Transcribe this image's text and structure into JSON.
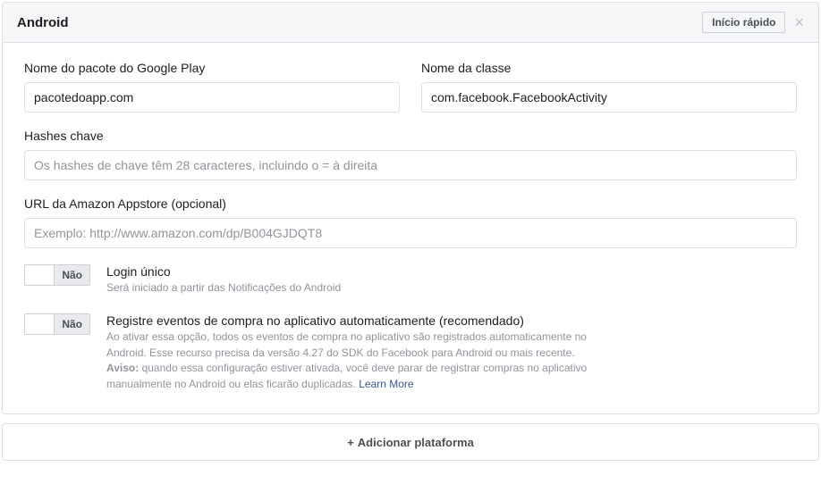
{
  "header": {
    "title": "Android",
    "quick_start": "Início rápido"
  },
  "fields": {
    "package_label": "Nome do pacote do Google Play",
    "package_value": "pacotedoapp.com",
    "class_label": "Nome da classe",
    "class_value": "com.facebook.FacebookActivity",
    "hashes_label": "Hashes chave",
    "hashes_placeholder": "Os hashes de chave têm 28 caracteres, incluindo o = à direita",
    "amazon_label": "URL da Amazon Appstore (opcional)",
    "amazon_placeholder": "Exemplo: http://www.amazon.com/dp/B004GJDQT8"
  },
  "toggles": {
    "off_label": "Não",
    "sso_title": "Login único",
    "sso_desc": "Será iniciado a partir das Notificações do Android",
    "purchase_title": "Registre eventos de compra no aplicativo automaticamente (recomendado)",
    "purchase_desc1": "Ao ativar essa opção, todos os eventos de compra no aplicativo são registrados automaticamente no Android. Esse recurso precisa da versão 4.27 do SDK do Facebook para Android ou mais recente.",
    "purchase_warn_label": "Aviso:",
    "purchase_warn_text": " quando essa configuração estiver ativada, você deve parar de registrar compras no aplicativo manualmente no Android ou elas ficarão duplicadas. ",
    "learn_more": "Learn More"
  },
  "footer": {
    "add_platform": "Adicionar plataforma"
  }
}
